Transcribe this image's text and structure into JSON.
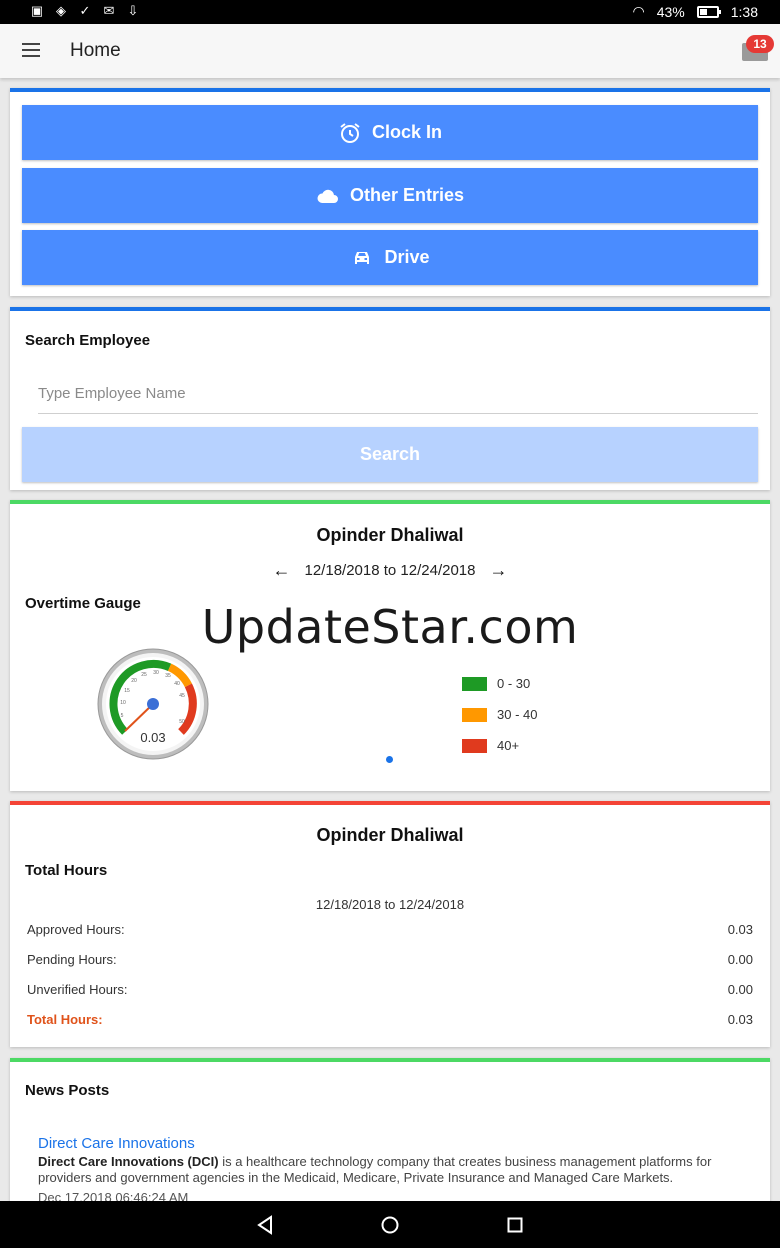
{
  "status_bar": {
    "battery": "43%",
    "time": "1:38"
  },
  "app_bar": {
    "title": "Home",
    "notification_count": "13"
  },
  "actions": {
    "clock_in": "Clock In",
    "other_entries": "Other Entries",
    "drive": "Drive"
  },
  "search": {
    "title": "Search Employee",
    "placeholder": "Type Employee Name",
    "button": "Search"
  },
  "gauge_card": {
    "employee": "Opinder Dhaliwal",
    "date_range": "12/18/2018 to 12/24/2018",
    "title": "Overtime Gauge",
    "value": "0.03",
    "gauge_ticks": [
      "5",
      "10",
      "15",
      "20",
      "25",
      "30",
      "35",
      "40",
      "45",
      "50"
    ],
    "legend": [
      {
        "label": "0 - 30",
        "color": "#1e9a25"
      },
      {
        "label": "30 - 40",
        "color": "#ff9800"
      },
      {
        "label": "40+",
        "color": "#e03a1e"
      }
    ],
    "watermark": "UpdateStar.com"
  },
  "hours_card": {
    "employee": "Opinder Dhaliwal",
    "title": "Total Hours",
    "date_range": "12/18/2018 to 12/24/2018",
    "rows": [
      {
        "label": "Approved Hours:",
        "value": "0.03"
      },
      {
        "label": "Pending Hours:",
        "value": "0.00"
      },
      {
        "label": "Unverified Hours:",
        "value": "0.00"
      },
      {
        "label": "Total Hours:",
        "value": "0.03"
      }
    ]
  },
  "news": {
    "title": "News Posts",
    "post_title": "Direct Care Innovations",
    "post_bold": "Direct Care Innovations (DCI)",
    "post_text": " is a healthcare technology company that creates business management platforms for providers and government agencies in the Medicaid, Medicare, Private Insurance and Managed Care Markets.",
    "post_date": "Dec 17,2018 06:46:24 AM"
  }
}
